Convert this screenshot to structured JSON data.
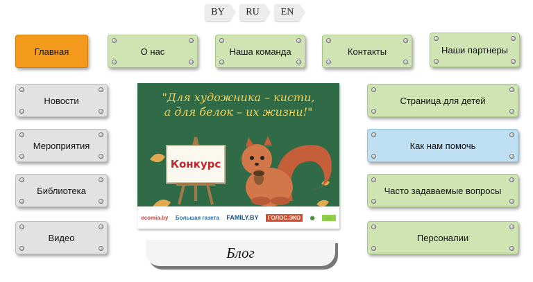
{
  "languages": [
    "BY",
    "RU",
    "EN"
  ],
  "top_nav": [
    "Главная",
    "О нас",
    "Наша команда",
    "Контакты",
    "Наши партнеры"
  ],
  "left_nav": [
    "Новости",
    "Мероприятия",
    "Библиотека",
    "Видео"
  ],
  "right_nav": [
    "Страница для детей",
    "Как нам помочь",
    "Часто задаваемые вопросы",
    "Персоналии"
  ],
  "banner": {
    "line1": "\"Для художника – кисти,",
    "line2": "а для белок – их жизни!\"",
    "board_text": "Конкурс",
    "logos": [
      "ecomia.by",
      "Большая газета",
      "FAMILY.BY",
      "ГОЛОС.ЭКО",
      "◉",
      "▭"
    ]
  },
  "blog_label": "Блог",
  "colors": {
    "active": "#f39a1c",
    "green": "#cfe4b2",
    "gray": "#e2e2e2",
    "blue": "#bfe0f2",
    "banner_bg": "#2f6b46",
    "banner_text": "#f2d25a"
  }
}
